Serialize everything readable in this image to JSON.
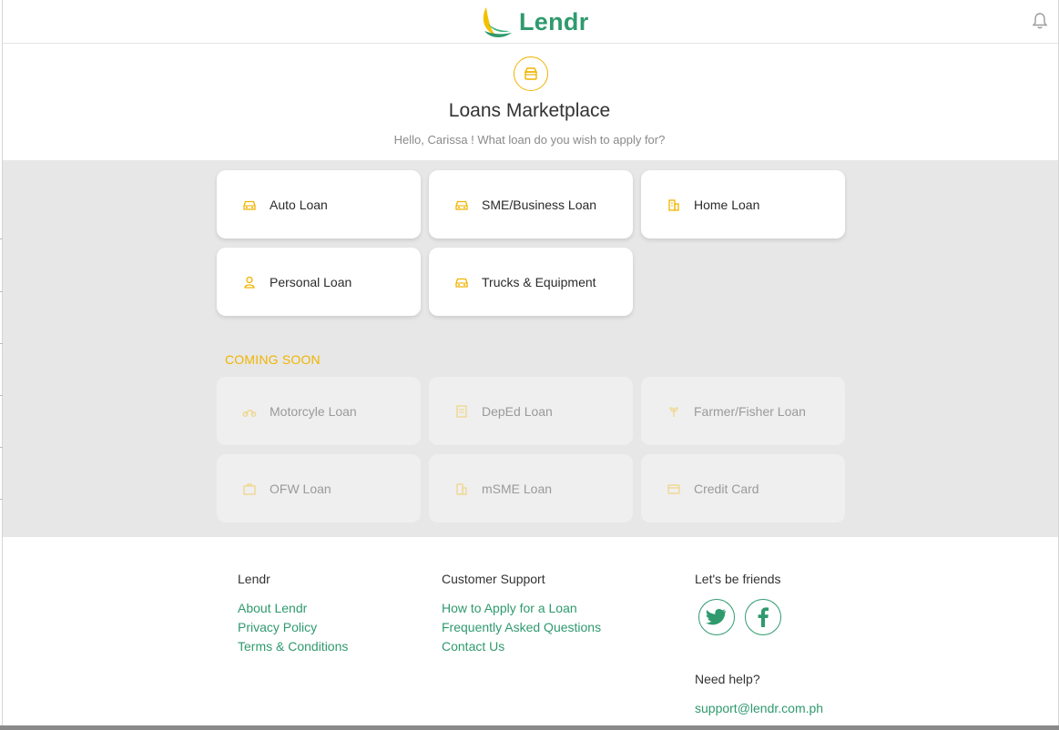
{
  "header": {
    "brand": "Lendr",
    "logo_icon": "lendr-leaf-logo",
    "notification_icon": "bell-icon"
  },
  "hero": {
    "icon": "storefront-icon",
    "title": "Loans Marketplace",
    "subtitle": "Hello, Carissa ! What loan do you wish to apply for?"
  },
  "loans": [
    {
      "label": "Auto Loan",
      "icon": "car-icon"
    },
    {
      "label": "SME/Business Loan",
      "icon": "car-icon"
    },
    {
      "label": "Home Loan",
      "icon": "building-icon"
    },
    {
      "label": "Personal Loan",
      "icon": "person-icon"
    },
    {
      "label": "Trucks & Equipment",
      "icon": "car-icon"
    }
  ],
  "coming_soon": {
    "heading": "COMING SOON",
    "items": [
      {
        "label": "Motorcyle Loan",
        "icon": "motorcycle-icon"
      },
      {
        "label": "DepEd Loan",
        "icon": "document-icon"
      },
      {
        "label": "Farmer/Fisher Loan",
        "icon": "sprout-icon"
      },
      {
        "label": "OFW Loan",
        "icon": "briefcase-icon"
      },
      {
        "label": "mSME Loan",
        "icon": "store-icon"
      },
      {
        "label": "Credit Card",
        "icon": "credit-card-icon"
      }
    ]
  },
  "footer": {
    "col1": {
      "title": "Lendr",
      "links": [
        "About Lendr",
        "Privacy Policy",
        "Terms & Conditions"
      ]
    },
    "col2": {
      "title": "Customer Support",
      "links": [
        "How to Apply for a Loan",
        "Frequently Asked Questions",
        "Contact Us"
      ]
    },
    "col3": {
      "title": "Let's be friends",
      "social": [
        "twitter-icon",
        "facebook-icon"
      ],
      "help_title": "Need help?",
      "email": "support@lendr.com.ph"
    }
  },
  "colors": {
    "brand_green": "#2f9a6e",
    "accent_yellow": "#f0b400",
    "band_gray": "#e7e7e7"
  }
}
